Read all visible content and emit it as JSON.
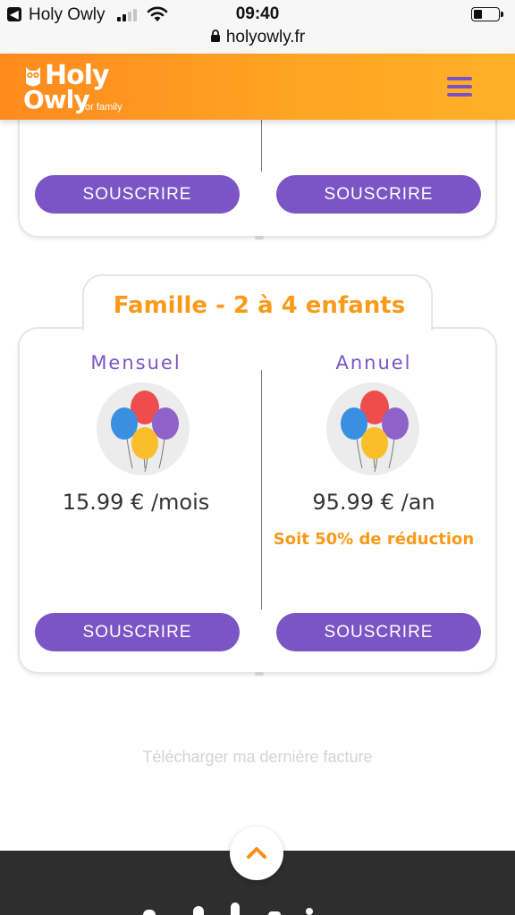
{
  "status_bar": {
    "back_app": "Holy Owly",
    "time": "09:40",
    "battery_level": 0.35
  },
  "browser": {
    "url": "holyowly.fr"
  },
  "header": {
    "logo_line1": "Holy",
    "logo_line2": "Owly",
    "logo_tagline": "for family",
    "accent_color": "#ff9a1f",
    "menu_icon": "hamburger-icon"
  },
  "top_card": {
    "left_button": "SOUSCRIRE",
    "right_button": "SOUSCRIRE"
  },
  "family_card": {
    "title": "Famille - 2 à 4 enfants",
    "monthly": {
      "label": "Mensuel",
      "price": "15.99 € /mois",
      "button": "SOUSCRIRE"
    },
    "yearly": {
      "label": "Annuel",
      "price": "95.99 € /an",
      "discount": "Soit 50% de réduction",
      "button": "SOUSCRIRE"
    },
    "button_color": "#7b55c5",
    "highlight_color": "#fb9a19"
  },
  "invoice_link": "Télécharger ma dernière facture",
  "scroll_top_icon": "chevron-up-icon"
}
